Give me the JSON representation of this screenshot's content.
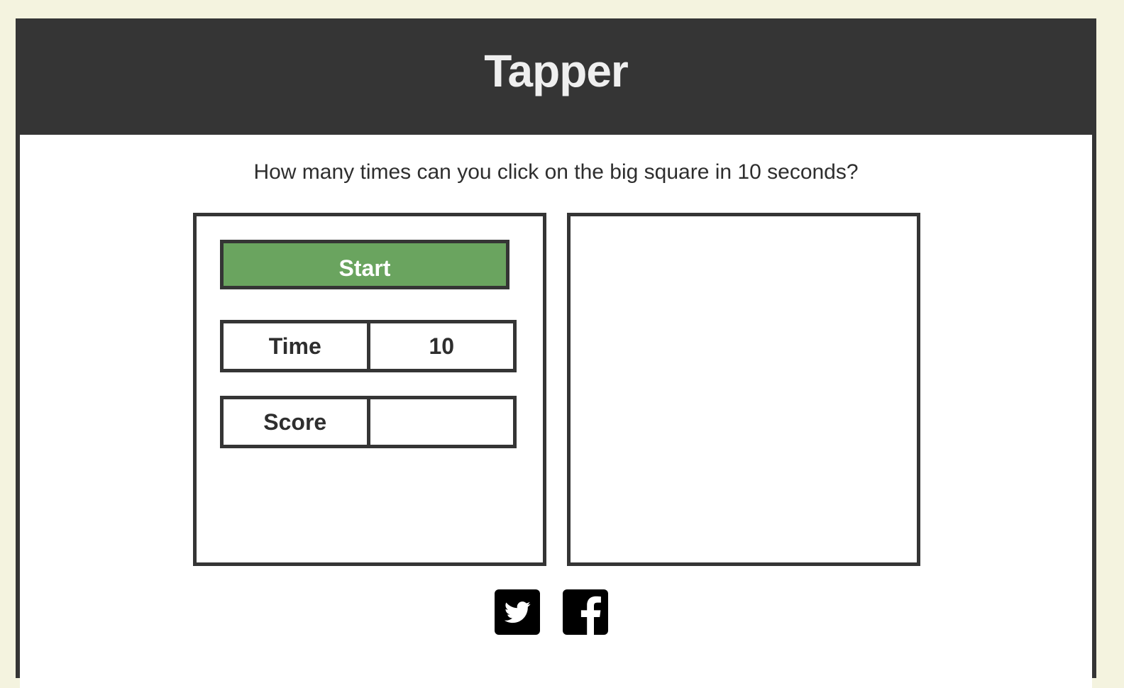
{
  "header": {
    "title": "Tapper"
  },
  "main": {
    "question": "How many times can you click on the big square in 10 seconds?",
    "start_label": "Start",
    "time_label": "Time",
    "time_value": "10",
    "score_label": "Score",
    "score_value": ""
  },
  "social": {
    "icons": [
      "twitter-icon",
      "facebook-icon"
    ]
  },
  "colors": {
    "background": "#f4f3df",
    "header": "#353535",
    "start_button": "#6aa45f",
    "border": "#353535"
  }
}
